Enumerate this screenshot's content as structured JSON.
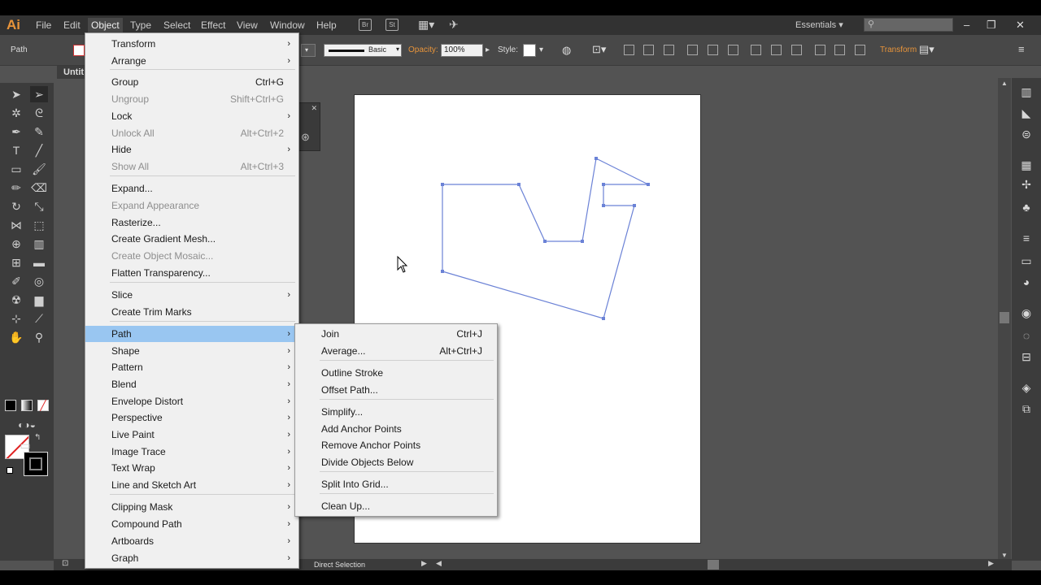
{
  "app": {
    "logo": "Ai"
  },
  "menubar": {
    "items": [
      "File",
      "Edit",
      "Object",
      "Type",
      "Select",
      "Effect",
      "View",
      "Window",
      "Help"
    ],
    "badges": [
      "Br",
      "St"
    ],
    "workspace": "Essentials",
    "window_controls": [
      "–",
      "❐",
      "✕"
    ]
  },
  "control": {
    "selection_label": "Path",
    "stroke_profile": "Basic",
    "opacity_label": "Opacity:",
    "opacity_value": "100%",
    "style_label": "Style:",
    "transform_label": "Transform"
  },
  "document": {
    "tab_title": "Untit"
  },
  "status": {
    "tool_name": "Direct Selection"
  },
  "colors": {
    "menu_highlight": "#99c6f1",
    "path": "#6b82d6",
    "accent_orange": "#e8943a"
  },
  "object_menu": [
    {
      "label": "Transform",
      "shortcut": "",
      "submenu": true,
      "disabled": false,
      "highlight": false
    },
    {
      "label": "Arrange",
      "shortcut": "",
      "submenu": true,
      "disabled": false,
      "highlight": false
    },
    {
      "label": "Group",
      "shortcut": "Ctrl+G",
      "submenu": false,
      "disabled": false,
      "highlight": false
    },
    {
      "label": "Ungroup",
      "shortcut": "Shift+Ctrl+G",
      "submenu": false,
      "disabled": true,
      "highlight": false
    },
    {
      "label": "Lock",
      "shortcut": "",
      "submenu": true,
      "disabled": false,
      "highlight": false
    },
    {
      "label": "Unlock All",
      "shortcut": "Alt+Ctrl+2",
      "submenu": false,
      "disabled": true,
      "highlight": false
    },
    {
      "label": "Hide",
      "shortcut": "",
      "submenu": true,
      "disabled": false,
      "highlight": false
    },
    {
      "label": "Show All",
      "shortcut": "Alt+Ctrl+3",
      "submenu": false,
      "disabled": true,
      "highlight": false
    },
    {
      "label": "Expand...",
      "shortcut": "",
      "submenu": false,
      "disabled": false,
      "highlight": false
    },
    {
      "label": "Expand Appearance",
      "shortcut": "",
      "submenu": false,
      "disabled": true,
      "highlight": false
    },
    {
      "label": "Rasterize...",
      "shortcut": "",
      "submenu": false,
      "disabled": false,
      "highlight": false
    },
    {
      "label": "Create Gradient Mesh...",
      "shortcut": "",
      "submenu": false,
      "disabled": false,
      "highlight": false
    },
    {
      "label": "Create Object Mosaic...",
      "shortcut": "",
      "submenu": false,
      "disabled": true,
      "highlight": false
    },
    {
      "label": "Flatten Transparency...",
      "shortcut": "",
      "submenu": false,
      "disabled": false,
      "highlight": false
    },
    {
      "label": "Slice",
      "shortcut": "",
      "submenu": true,
      "disabled": false,
      "highlight": false
    },
    {
      "label": "Create Trim Marks",
      "shortcut": "",
      "submenu": false,
      "disabled": false,
      "highlight": false
    },
    {
      "label": "Path",
      "shortcut": "",
      "submenu": true,
      "disabled": false,
      "highlight": true
    },
    {
      "label": "Shape",
      "shortcut": "",
      "submenu": true,
      "disabled": false,
      "highlight": false
    },
    {
      "label": "Pattern",
      "shortcut": "",
      "submenu": true,
      "disabled": false,
      "highlight": false
    },
    {
      "label": "Blend",
      "shortcut": "",
      "submenu": true,
      "disabled": false,
      "highlight": false
    },
    {
      "label": "Envelope Distort",
      "shortcut": "",
      "submenu": true,
      "disabled": false,
      "highlight": false
    },
    {
      "label": "Perspective",
      "shortcut": "",
      "submenu": true,
      "disabled": false,
      "highlight": false
    },
    {
      "label": "Live Paint",
      "shortcut": "",
      "submenu": true,
      "disabled": false,
      "highlight": false
    },
    {
      "label": "Image Trace",
      "shortcut": "",
      "submenu": true,
      "disabled": false,
      "highlight": false
    },
    {
      "label": "Text Wrap",
      "shortcut": "",
      "submenu": true,
      "disabled": false,
      "highlight": false
    },
    {
      "label": "Line and Sketch Art",
      "shortcut": "",
      "submenu": true,
      "disabled": false,
      "highlight": false
    },
    {
      "label": "Clipping Mask",
      "shortcut": "",
      "submenu": true,
      "disabled": false,
      "highlight": false
    },
    {
      "label": "Compound Path",
      "shortcut": "",
      "submenu": true,
      "disabled": false,
      "highlight": false
    },
    {
      "label": "Artboards",
      "shortcut": "",
      "submenu": true,
      "disabled": false,
      "highlight": false
    },
    {
      "label": "Graph",
      "shortcut": "",
      "submenu": true,
      "disabled": false,
      "highlight": false
    }
  ],
  "path_submenu": [
    {
      "label": "Join",
      "shortcut": "Ctrl+J"
    },
    {
      "label": "Average...",
      "shortcut": "Alt+Ctrl+J"
    },
    {
      "label": "Outline Stroke",
      "shortcut": ""
    },
    {
      "label": "Offset Path...",
      "shortcut": ""
    },
    {
      "label": "Simplify...",
      "shortcut": ""
    },
    {
      "label": "Add Anchor Points",
      "shortcut": ""
    },
    {
      "label": "Remove Anchor Points",
      "shortcut": ""
    },
    {
      "label": "Divide Objects Below",
      "shortcut": ""
    },
    {
      "label": "Split Into Grid...",
      "shortcut": ""
    },
    {
      "label": "Clean Up...",
      "shortcut": ""
    }
  ]
}
